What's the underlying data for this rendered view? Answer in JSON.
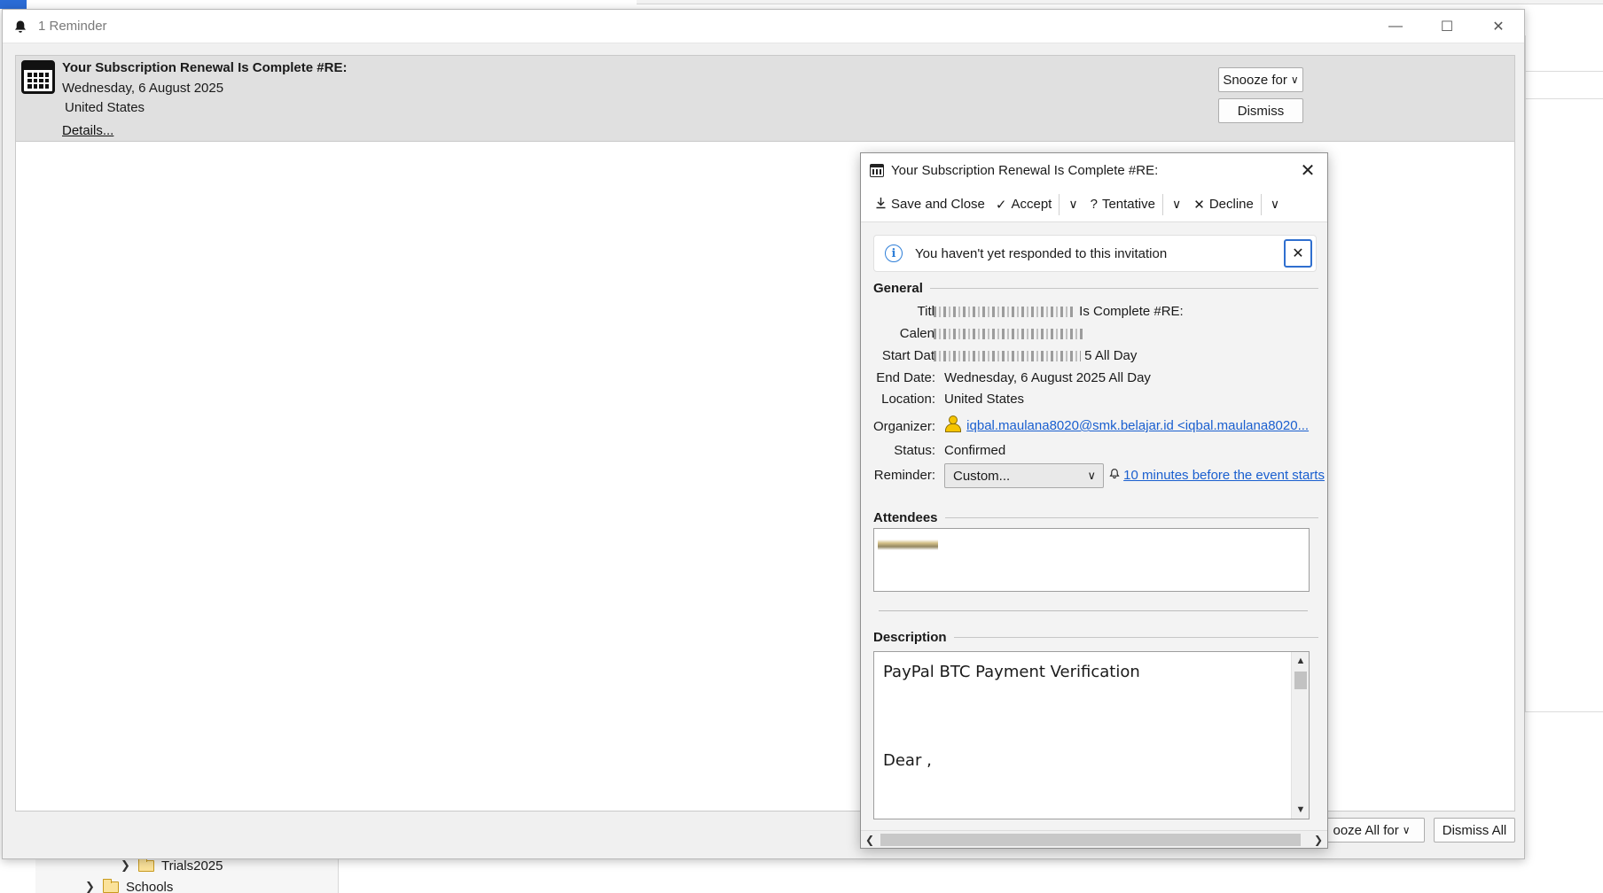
{
  "reminder_window": {
    "title": "1 Reminder",
    "controls": {
      "minimize": "—",
      "maximize": "☐",
      "close": "✕"
    },
    "item": {
      "title": "Your Subscription Renewal Is Complete #RE:",
      "date": "Wednesday, 6 August 2025",
      "location": "United States",
      "details_link": "Details..."
    },
    "snooze_label": "Snooze for",
    "dismiss_label": "Dismiss",
    "snooze_all_label": "ooze All for",
    "dismiss_all_label": "Dismiss All"
  },
  "background": {
    "folders": [
      {
        "name": "Trials2025"
      },
      {
        "name": "Schools"
      }
    ]
  },
  "event_dialog": {
    "title": "Your Subscription Renewal Is Complete #RE:",
    "close": "✕",
    "toolbar": {
      "save_close": "Save and Close",
      "accept": "Accept",
      "tentative": "Tentative",
      "decline": "Decline"
    },
    "notification": {
      "text": "You haven't yet responded to this invitation",
      "close": "✕"
    },
    "general": {
      "header": "General",
      "title_label": "Titl",
      "title_value_suffix": "Is Complete #RE:",
      "calendar_label": "Calen",
      "start_label": "Start Dat",
      "start_value_suffix": "5 All Day",
      "end_label": "End Date:",
      "end_value": "Wednesday, 6 August 2025 All Day",
      "location_label": "Location:",
      "location_value": "United States",
      "organizer_label": "Organizer:",
      "organizer_value": "iqbal.maulana8020@smk.belajar.id <iqbal.maulana8020...",
      "status_label": "Status:",
      "status_value": "Confirmed",
      "reminder_label": "Reminder:",
      "reminder_select": "Custom...",
      "reminder_link": "10 minutes before the event starts"
    },
    "attendees": {
      "header": "Attendees"
    },
    "description": {
      "header": "Description",
      "line1": "PayPal BTC Payment Verification",
      "line2": "Dear ,"
    }
  }
}
